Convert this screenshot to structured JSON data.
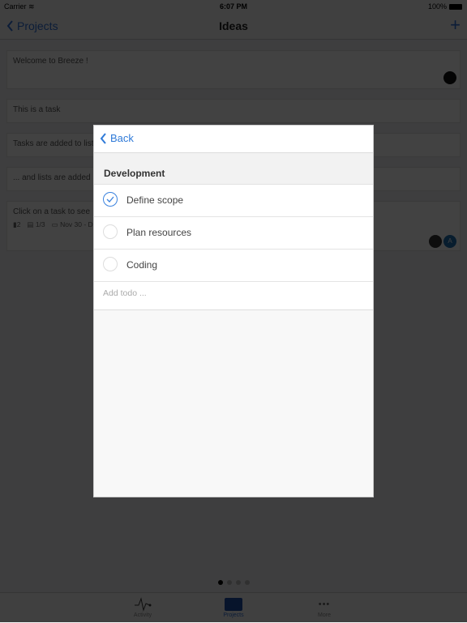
{
  "status_bar": {
    "carrier": "Carrier",
    "time": "6:07 PM",
    "battery": "100%"
  },
  "nav": {
    "back_label": "Projects",
    "title": "Ideas",
    "add_icon": "plus-icon"
  },
  "cards": [
    {
      "text": "Welcome to Breeze !"
    },
    {
      "text": "This is a task"
    },
    {
      "text": "Tasks are added to lists"
    },
    {
      "text": "... and lists are added"
    },
    {
      "text": "Click on a task to see",
      "attachments": "2",
      "todos": "1/3",
      "dates": "Nov 30 - D",
      "avatar_initial": "A"
    }
  ],
  "page_dots": {
    "count": 4,
    "active": 0
  },
  "tabbar": [
    {
      "label": "Activity",
      "icon": "activity-icon"
    },
    {
      "label": "Projects",
      "icon": "folder-icon",
      "active": true
    },
    {
      "label": "More",
      "icon": "more-icon"
    }
  ],
  "modal": {
    "back_label": "Back",
    "section_title": "Development",
    "todos": [
      {
        "label": "Define scope",
        "done": true
      },
      {
        "label": "Plan resources",
        "done": false
      },
      {
        "label": "Coding",
        "done": false
      }
    ],
    "add_placeholder": "Add todo ..."
  },
  "colors": {
    "accent": "#2f7ad8",
    "overlay": "rgba(0,0,0,0.74)"
  }
}
